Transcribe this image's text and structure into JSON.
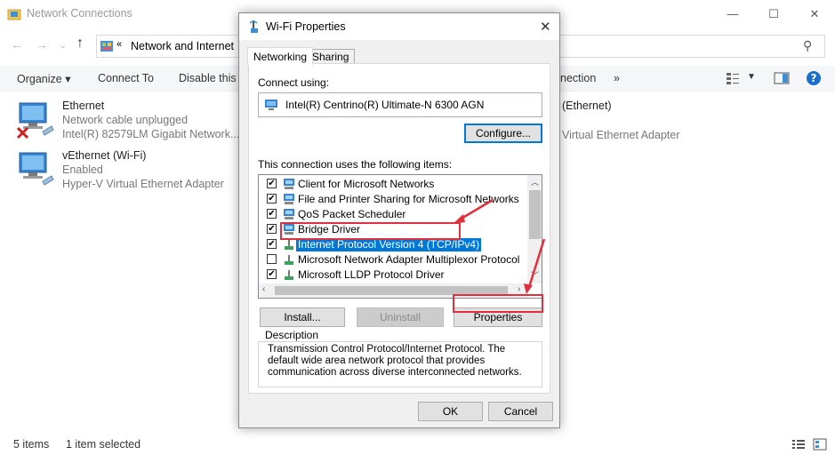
{
  "explorer": {
    "title": "Network Connections",
    "address": "Network and Internet",
    "address_prefix": "«",
    "commands": [
      "Organize ▾",
      "Connect To",
      "Disable this r",
      "nection",
      "»"
    ],
    "items": [
      {
        "name": "Ethernet",
        "status": "Network cable unplugged",
        "adapter": "Intel(R) 82579LM Gigabit Network..."
      },
      {
        "name": "vEthernet (Wi-Fi)",
        "status": "Enabled",
        "adapter": "Hyper-V Virtual Ethernet Adapter"
      }
    ],
    "right_item": {
      "name": "(Ethernet)",
      "adapter": "Virtual Ethernet Adapter"
    },
    "status": {
      "count": "5 items",
      "selected": "1 item selected"
    }
  },
  "dialog": {
    "title": "Wi-Fi Properties",
    "tabs": [
      "Networking",
      "Sharing"
    ],
    "connect_using_label": "Connect using:",
    "adapter": "Intel(R) Centrino(R) Ultimate-N 6300 AGN",
    "configure_button": "Configure...",
    "items_label": "This connection uses the following items:",
    "items": [
      {
        "label": "Client for Microsoft Networks",
        "checked": true
      },
      {
        "label": "File and Printer Sharing for Microsoft Networks",
        "checked": true
      },
      {
        "label": "QoS Packet Scheduler",
        "checked": true
      },
      {
        "label": "Bridge Driver",
        "checked": true
      },
      {
        "label": "Internet Protocol Version 4 (TCP/IPv4)",
        "checked": true
      },
      {
        "label": "Microsoft Network Adapter Multiplexor Protocol",
        "checked": false
      },
      {
        "label": "Microsoft LLDP Protocol Driver",
        "checked": true
      }
    ],
    "install_button": "Install...",
    "uninstall_button": "Uninstall",
    "properties_button": "Properties",
    "description_label": "Description",
    "description_text": "Transmission Control Protocol/Internet Protocol. The default wide area network protocol that provides communication across diverse interconnected networks.",
    "ok_button": "OK",
    "cancel_button": "Cancel"
  },
  "colors": {
    "selection": "#0078d7",
    "annotation": "#e0303d",
    "accent_border": "#0078d7"
  }
}
